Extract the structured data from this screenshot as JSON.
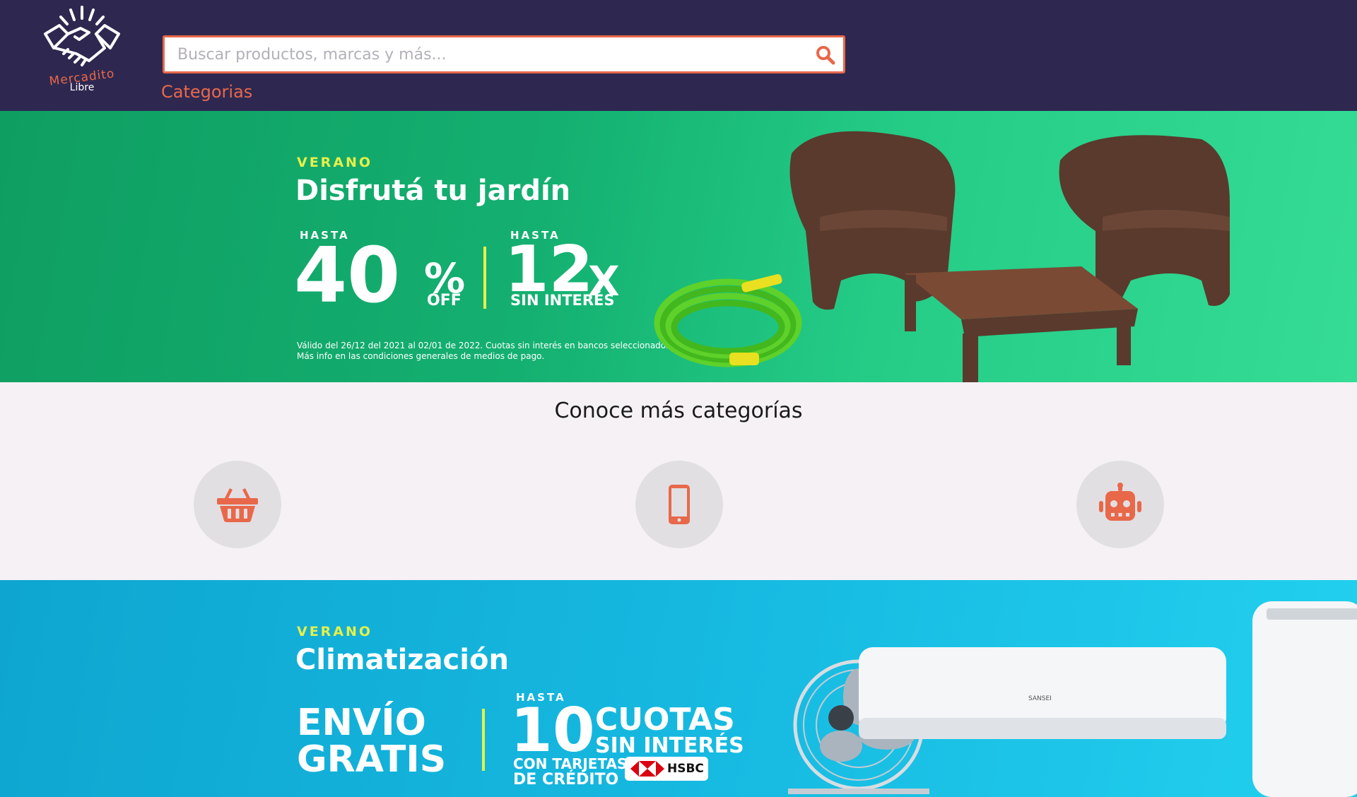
{
  "brand": {
    "name_line1": "Mercadito",
    "name_line2": "Libre",
    "logo_icon": "handshake-icon",
    "accent_color": "#e8684a",
    "header_bg": "#2e2850"
  },
  "search": {
    "placeholder": "Buscar productos, marcas y más...",
    "value": "",
    "icon": "search-icon"
  },
  "nav": {
    "categories_label": "Categorias"
  },
  "banner1": {
    "kicker": "VERANO",
    "title": "Disfrutá tu jardín",
    "left_small": "HASTA",
    "left_big": "40",
    "left_pct": "%",
    "left_sub": "OFF",
    "right_small": "HASTA",
    "right_big": "12",
    "right_x": "X",
    "right_sub": "SIN INTERÉS",
    "legal_line1": "Válido del 26/12 del 2021 al 02/01 de 2022. Cuotas sin interés en bancos seleccionados.",
    "legal_line2": "Más info en las condiciones generales de medios de pago."
  },
  "categories": {
    "title": "Conoce más categorías",
    "items": [
      {
        "icon": "basket-icon"
      },
      {
        "icon": "mobile-phone-icon"
      },
      {
        "icon": "robot-icon"
      }
    ]
  },
  "banner2": {
    "kicker": "VERANO",
    "title": "Climatización",
    "left_line1": "ENVÍO",
    "left_line2": "GRATIS",
    "right_small": "HASTA",
    "right_big": "10",
    "right_line1": "CUOTAS",
    "right_line2": "SIN INTERÉS",
    "card_line1": "CON TARJETAS",
    "card_line2": "DE CRÉDITO",
    "bank": "HSBC",
    "ac_brand": "SANSEI"
  }
}
